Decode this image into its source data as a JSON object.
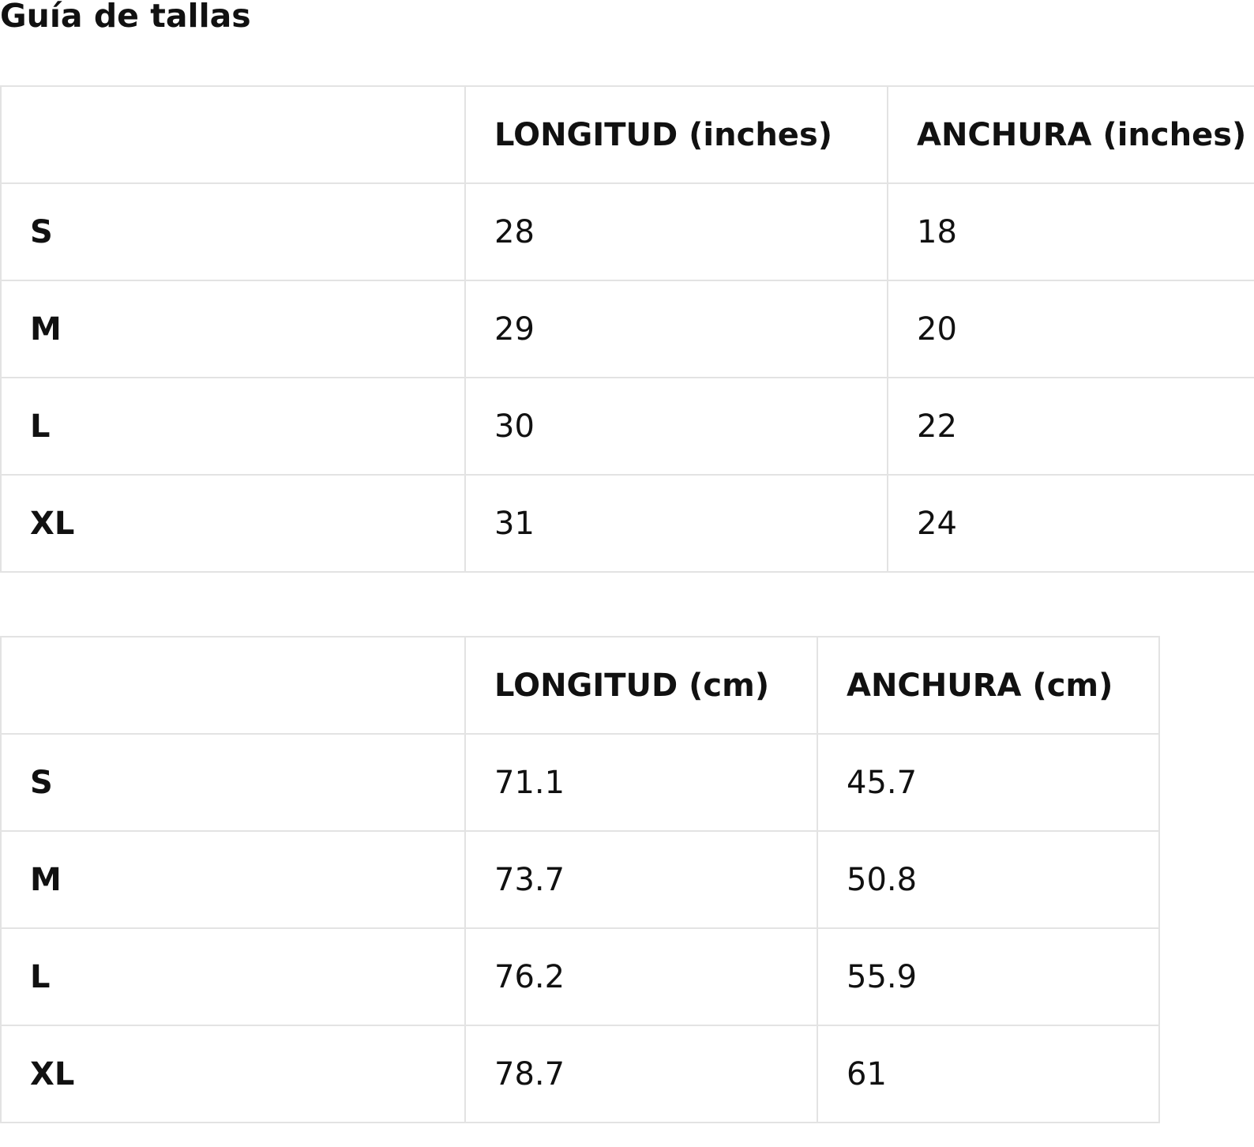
{
  "title": "Guía de tallas",
  "tables": [
    {
      "headers": [
        "",
        "LONGITUD (inches)",
        "ANCHURA (inches)"
      ],
      "rows": [
        [
          "S",
          "28",
          "18"
        ],
        [
          "M",
          "29",
          "20"
        ],
        [
          "L",
          "30",
          "22"
        ],
        [
          "XL",
          "31",
          "24"
        ]
      ]
    },
    {
      "headers": [
        "",
        "LONGITUD (cm)",
        "ANCHURA (cm)"
      ],
      "rows": [
        [
          "S",
          "71.1",
          "45.7"
        ],
        [
          "M",
          "73.7",
          "50.8"
        ],
        [
          "L",
          "76.2",
          "55.9"
        ],
        [
          "XL",
          "78.7",
          "61"
        ]
      ]
    }
  ],
  "colors": {
    "text": "#111111",
    "border": "#e3e3e3",
    "background": "#ffffff"
  }
}
